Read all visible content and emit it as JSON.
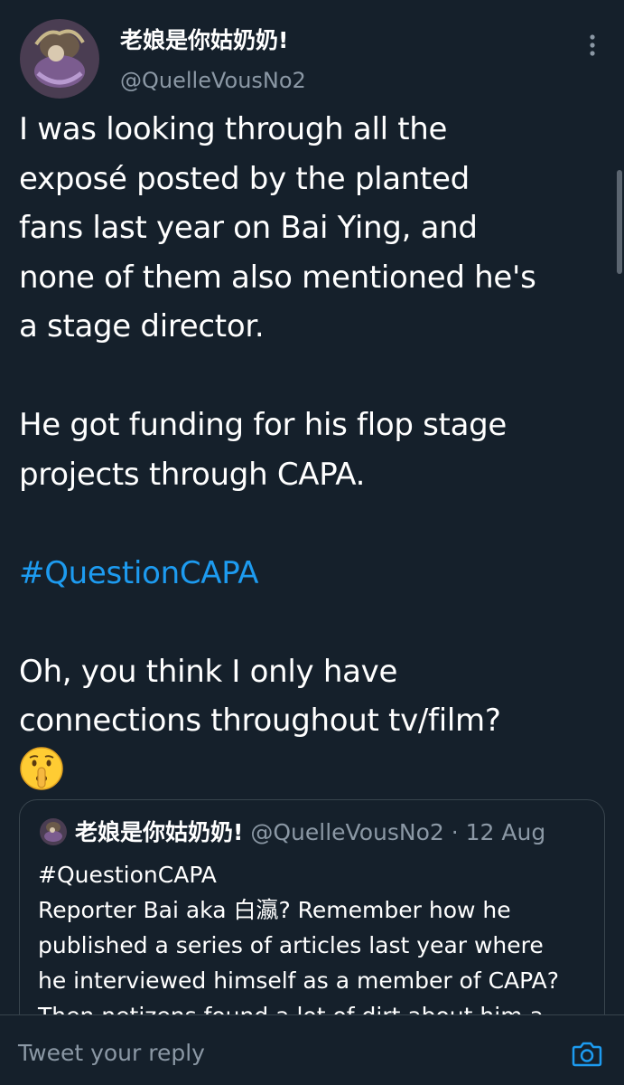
{
  "tweet": {
    "author": {
      "display_name": "老娘是你姑奶奶!",
      "handle": "@QuelleVousNo2"
    },
    "paragraphs": [
      [
        "I was looking through all the",
        "exposé posted by the planted",
        "fans last year on Bai Ying, and",
        "none of them also mentioned he's",
        "a stage director."
      ],
      [
        "He got funding for his flop stage",
        "projects through CAPA."
      ]
    ],
    "hashtag": "#QuestionCAPA",
    "closing_lines": [
      "Oh, you think I only have",
      "connections throughout tv/film?"
    ],
    "emoji": "shushing-face-emoji"
  },
  "quoted_tweet": {
    "display_name": "老娘是你姑奶奶!",
    "handle": "@QuelleVousNo2",
    "separator": "·",
    "date": "12 Aug",
    "lines": [
      "#QuestionCAPA",
      "Reporter Bai aka 白瀛? Remember how he",
      "published a series of articles last year where",
      "he interviewed himself as a member of CAPA?",
      "Then netizens found a lot of dirt about him a"
    ]
  },
  "reply_bar": {
    "placeholder": "Tweet your reply",
    "camera_icon": "camera-icon"
  },
  "colors": {
    "background": "#15202b",
    "text": "#ffffff",
    "secondary_text": "#8b98a5",
    "link": "#1d9bf0",
    "border": "#38444d"
  }
}
